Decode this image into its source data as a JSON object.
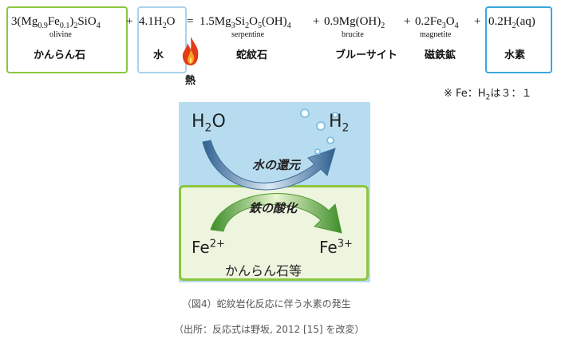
{
  "equation": {
    "olivine_formula": "3(Mg0.9Fe0.1)2SiO4",
    "water_formula": "4.1H2O",
    "equals": "=",
    "serpentine_formula": "1.5Mg3Si2O5(OH)4",
    "brucite_formula": "0.9Mg(OH)2",
    "magnetite_formula": "0.2Fe3O4",
    "hydrogen_formula": "0.2H2(aq)",
    "plus": "+",
    "terms": {
      "olivine": {
        "mineral": "olivine",
        "jp": "かんらん石"
      },
      "water": {
        "jp": "水"
      },
      "serpentine": {
        "mineral": "serpentine",
        "jp": "蛇紋石"
      },
      "brucite": {
        "mineral": "brucite",
        "jp": "ブルーサイト"
      },
      "magnetite": {
        "mineral": "magnetite",
        "jp": "磁鉄鉱"
      },
      "hydrogen": {
        "jp": "水素"
      }
    },
    "heat_label": "熱"
  },
  "ratio_note": "※ Fe：H2は３：１",
  "diagram": {
    "h2o": "H2O",
    "h2": "H2",
    "water_reduction": "水の還元",
    "iron_oxidation": "鉄の酸化",
    "fe2": "Fe2+",
    "fe3": "Fe3+",
    "olivine_etc": "かんらん石等",
    "colors": {
      "water_bg": "#b8dcef",
      "rock_bg": "#eef5df",
      "rock_border": "#8cc63f",
      "arrow_blue": "#4a7fb0",
      "arrow_green": "#6cb33e"
    }
  },
  "caption": "（図4）蛇紋岩化反応に伴う水素の発生",
  "source": "（出所：反応式は野坂, 2012 [15] を改変）"
}
